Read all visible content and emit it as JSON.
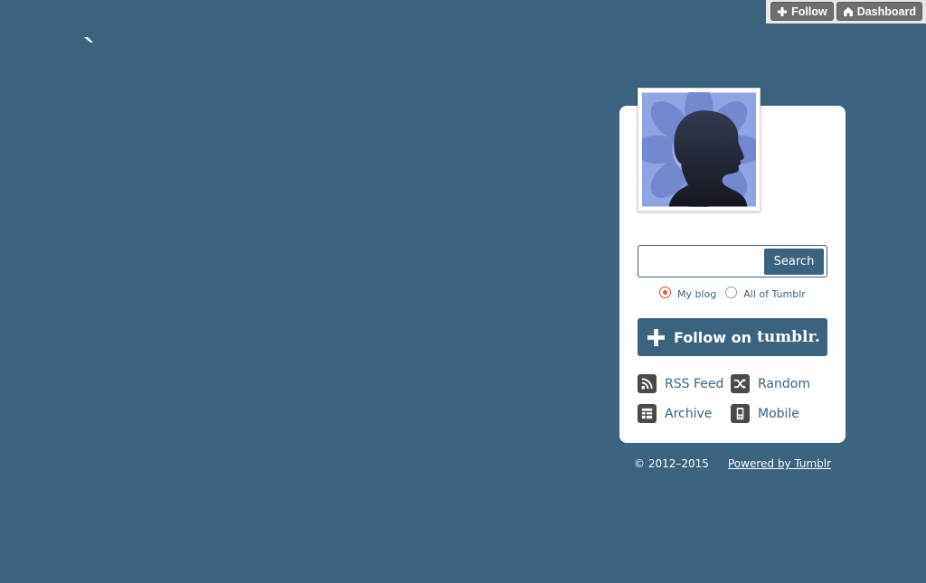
{
  "controls": {
    "follow_label": "Follow",
    "dashboard_label": "Dashboard"
  },
  "search": {
    "input_value": "",
    "placeholder": "",
    "button_label": "Search",
    "scopes": [
      {
        "label": "My blog",
        "checked": true
      },
      {
        "label": "All of Tumblr",
        "checked": false
      }
    ]
  },
  "follow_button": {
    "label": "Follow on",
    "brand": "tumblr."
  },
  "links": [
    {
      "label": "RSS Feed",
      "icon": "rss-icon"
    },
    {
      "label": "Random",
      "icon": "shuffle-icon"
    },
    {
      "label": "Archive",
      "icon": "archive-icon"
    },
    {
      "label": "Mobile",
      "icon": "mobile-icon"
    }
  ],
  "footer": {
    "copyright": "© 2012–2015",
    "powered": "Powered by Tumblr"
  },
  "colors": {
    "background": "#3b627f",
    "accent": "#3b627f",
    "card": "#ffffff",
    "radio_checked": "#d9622e"
  }
}
